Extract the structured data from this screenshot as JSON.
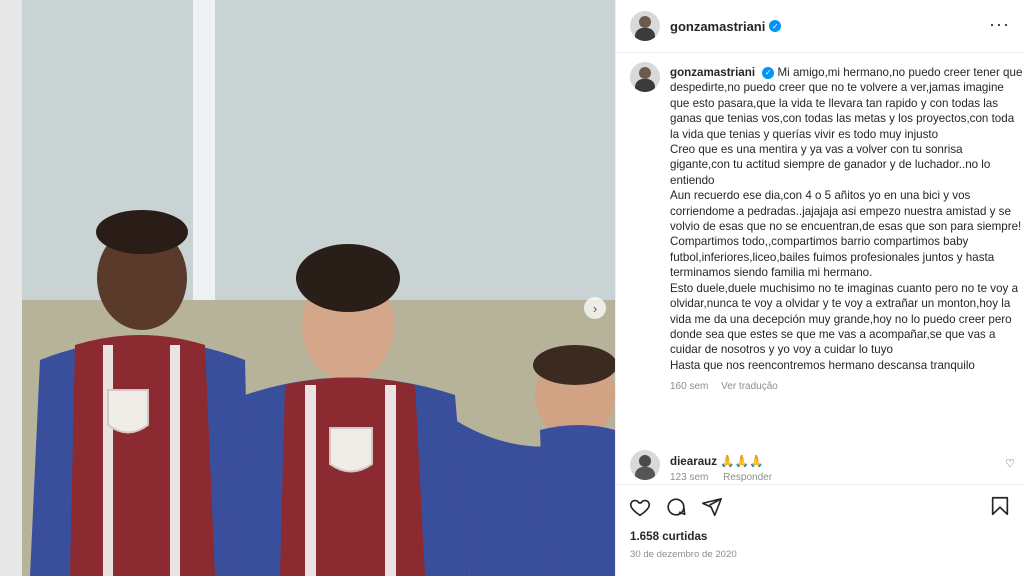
{
  "post": {
    "username": "gonzamastriani",
    "verified_symbol": "✓",
    "more_symbol": "···"
  },
  "caption": {
    "username": "gonzamastriani",
    "paragraphs": [
      "Mi amigo,mi hermano,no puedo creer tener que despedirte,no puedo creer que no te volvere a ver,jamas imagine que esto pasara,que la vida te llevara tan rapido y con todas las ganas que tenias vos,con todas las metas y los proyectos,con toda la vida que tenias y querías vivir es todo muy injusto",
      "Creo que es una mentira y ya vas a volver con tu sonrisa gigante,con tu actitud siempre de ganador y de luchador..no lo entiendo",
      "Aun recuerdo ese dia,con 4 o 5 añitos yo en una bici y vos corriendome a pedradas..jajajaja asi empezo nuestra amistad y se volvio de esas que no se encuentran,de esas que son para siempre!",
      "Compartimos todo,,compartimos barrio compartimos baby futbol,inferiores,liceo,bailes fuimos profesionales juntos y hasta terminamos siendo familia mi hermano.",
      "Esto duele,duele muchisimo no te imaginas cuanto pero no te voy a olvidar,nunca te voy a olvidar y te voy a extrañar un monton,hoy la vida me da una decepción muy grande,hoy no lo puedo creer pero donde sea que estes se que me vas a acompañar,se que vas a cuidar de nosotros y yo voy a cuidar lo tuyo",
      "Hasta que nos reencontremos hermano descansa tranquilo"
    ],
    "time": "160 sem",
    "translate": "Ver tradução"
  },
  "comment": {
    "username": "diearauz",
    "text": "🙏🙏🙏",
    "time": "123 sem",
    "reply": "Responder"
  },
  "footer": {
    "likes": "1.658 curtidas",
    "date": "30 de dezembro de 2020"
  },
  "icons": {
    "like": "heart-icon",
    "comment": "comment-icon",
    "share": "share-icon",
    "save": "bookmark-icon",
    "carousel": "chevron-right-icon"
  },
  "colors": {
    "verified": "#0095f6",
    "muted": "#8e8e8e",
    "jersey_red": "#8b2a30",
    "jersey_blue": "#3a4f9c"
  }
}
